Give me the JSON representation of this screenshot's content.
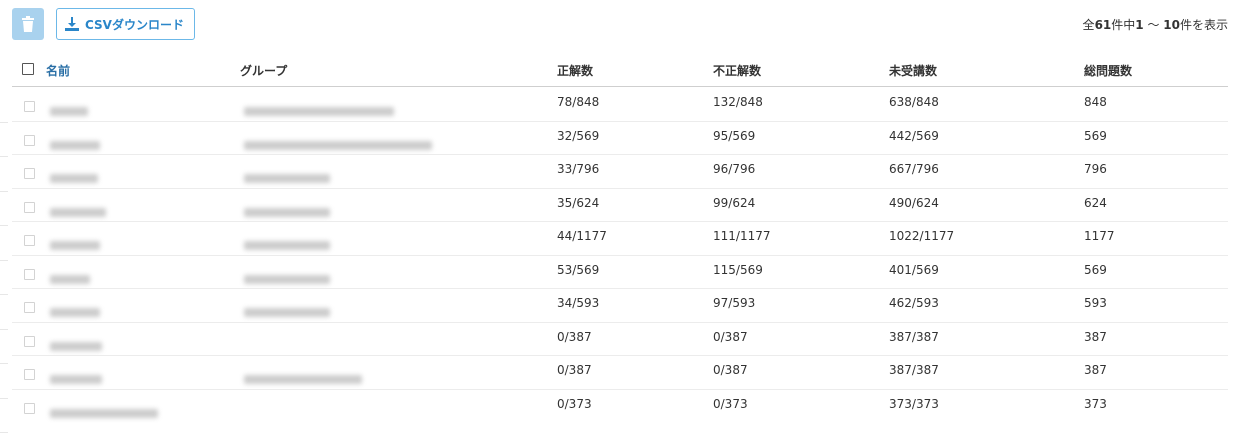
{
  "toolbar": {
    "delete_icon": "trash-icon",
    "csv_icon": "download-icon",
    "csv_label": "CSVダウンロード"
  },
  "pagination": {
    "prefix": "全",
    "total": "61",
    "mid": "件中",
    "from": "1",
    "sep": " 〜 ",
    "to": "10",
    "suffix": "件を表示"
  },
  "table": {
    "headers": {
      "name": "名前",
      "group": "グループ",
      "correct": "正解数",
      "incorrect": "不正解数",
      "unattempted": "未受講数",
      "total": "総問題数"
    },
    "rows": [
      {
        "correct": "78/848",
        "incorrect": "132/848",
        "unattempted": "638/848",
        "total": "848"
      },
      {
        "correct": "32/569",
        "incorrect": "95/569",
        "unattempted": "442/569",
        "total": "569"
      },
      {
        "correct": "33/796",
        "incorrect": "96/796",
        "unattempted": "667/796",
        "total": "796"
      },
      {
        "correct": "35/624",
        "incorrect": "99/624",
        "unattempted": "490/624",
        "total": "624"
      },
      {
        "correct": "44/1177",
        "incorrect": "111/1177",
        "unattempted": "1022/1177",
        "total": "1177"
      },
      {
        "correct": "53/569",
        "incorrect": "115/569",
        "unattempted": "401/569",
        "total": "569"
      },
      {
        "correct": "34/593",
        "incorrect": "97/593",
        "unattempted": "462/593",
        "total": "593"
      },
      {
        "correct": "0/387",
        "incorrect": "0/387",
        "unattempted": "387/387",
        "total": "387"
      },
      {
        "correct": "0/387",
        "incorrect": "0/387",
        "unattempted": "387/387",
        "total": "387"
      },
      {
        "correct": "0/373",
        "incorrect": "0/373",
        "unattempted": "373/373",
        "total": "373"
      }
    ]
  },
  "colors": {
    "accent": "#2a86c9",
    "delete_button": "#a9d2ee"
  }
}
